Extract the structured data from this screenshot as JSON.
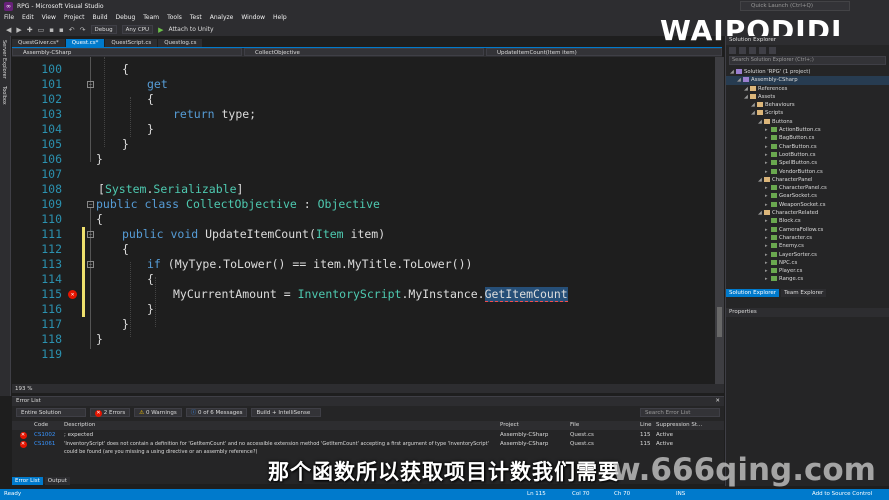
{
  "window": {
    "title": "RPG - Microsoft Visual Studio",
    "quick_launch": "Quick Launch (Ctrl+Q)",
    "user": "Kasper Frandsen",
    "avatar": "KA"
  },
  "menu": [
    "File",
    "Edit",
    "View",
    "Project",
    "Build",
    "Debug",
    "Team",
    "Tools",
    "Test",
    "Analyze",
    "Window",
    "Help"
  ],
  "toolbar": {
    "config": "Debug",
    "platform": "Any CPU",
    "attach": "Attach to Unity"
  },
  "watermark": "WAIPODIDI",
  "left_strip": [
    "Server Explorer",
    "Toolbox"
  ],
  "doc_tabs": [
    {
      "label": "QuestGiver.cs*",
      "active": false
    },
    {
      "label": "Quest.cs*",
      "active": true
    },
    {
      "label": "QuestScript.cs",
      "active": false
    },
    {
      "label": "Questlog.cs",
      "active": false
    }
  ],
  "nav": {
    "project": "Assembly-CSharp",
    "class": "CollectObjective",
    "member": "UpdateItemCount(Item item)"
  },
  "code_lines": [
    {
      "n": "100",
      "text": "{"
    },
    {
      "n": "101",
      "text": "get"
    },
    {
      "n": "102",
      "text": "{"
    },
    {
      "n": "103",
      "text": "return type;"
    },
    {
      "n": "104",
      "text": "}"
    },
    {
      "n": "105",
      "text": "}"
    },
    {
      "n": "106",
      "text": "}"
    },
    {
      "n": "107",
      "text": ""
    },
    {
      "n": "108",
      "text": "[System.Serializable]"
    },
    {
      "n": "109",
      "text": "public class CollectObjective : Objective"
    },
    {
      "n": "110",
      "text": "{"
    },
    {
      "n": "111",
      "text": "public void UpdateItemCount(Item item)"
    },
    {
      "n": "112",
      "text": "{"
    },
    {
      "n": "113",
      "text": "if (MyType.ToLower() == item.MyTitle.ToLower())"
    },
    {
      "n": "114",
      "text": "{"
    },
    {
      "n": "115",
      "text": "MyCurrentAmount = InventoryScript.MyInstance.GetItemCount"
    },
    {
      "n": "116",
      "text": "}"
    },
    {
      "n": "117",
      "text": "}"
    },
    {
      "n": "118",
      "text": "}"
    },
    {
      "n": "119",
      "text": ""
    }
  ],
  "zoom": "193 %",
  "error_list": {
    "title": "Error List",
    "scope": "Entire Solution",
    "errors_btn": "2 Errors",
    "warnings_btn": "0 Warnings",
    "messages_btn": "0 of 6 Messages",
    "build_filter": "Build + IntelliSense",
    "search": "Search Error List",
    "headers": [
      "",
      "Code",
      "Description",
      "Project",
      "File",
      "Line",
      "Suppression St..."
    ],
    "rows": [
      {
        "code": "CS1002",
        "desc": "; expected",
        "project": "Assembly-CSharp",
        "file": "Quest.cs",
        "line": "115",
        "state": "Active"
      },
      {
        "code": "CS1061",
        "desc": "'InventoryScript' does not contain a definition for 'GetItemCount' and no accessible extension method 'GetItemCount' accepting a first argument of type 'InventoryScript' could be found (are you missing a using directive or an assembly reference?)",
        "project": "Assembly-CSharp",
        "file": "Quest.cs",
        "line": "115",
        "state": "Active"
      }
    ],
    "bottom_tabs": [
      "Error List",
      "Output"
    ]
  },
  "solution_explorer": {
    "title": "Solution Explorer",
    "search": "Search Solution Explorer (Ctrl+;)",
    "items": [
      {
        "label": "Solution 'RPG' (1 project)",
        "lvl": 0
      },
      {
        "label": "Assembly-CSharp",
        "lvl": 1
      },
      {
        "label": "References",
        "lvl": 2
      },
      {
        "label": "Assets",
        "lvl": 2
      },
      {
        "label": "Behaviours",
        "lvl": 3
      },
      {
        "label": "Scripts",
        "lvl": 3
      },
      {
        "label": "Buttons",
        "lvl": 4
      },
      {
        "label": "ActionButton.cs",
        "lvl": 5
      },
      {
        "label": "BagButton.cs",
        "lvl": 5
      },
      {
        "label": "CharButton.cs",
        "lvl": 5
      },
      {
        "label": "LootButton.cs",
        "lvl": 5
      },
      {
        "label": "SpellButton.cs",
        "lvl": 5
      },
      {
        "label": "VendorButton.cs",
        "lvl": 5
      },
      {
        "label": "CharacterPanel",
        "lvl": 4
      },
      {
        "label": "CharacterPanel.cs",
        "lvl": 5
      },
      {
        "label": "GearSocket.cs",
        "lvl": 5
      },
      {
        "label": "WeaponSocket.cs",
        "lvl": 5
      },
      {
        "label": "CharacterRelated",
        "lvl": 4
      },
      {
        "label": "Block.cs",
        "lvl": 5
      },
      {
        "label": "CameraFollow.cs",
        "lvl": 5
      },
      {
        "label": "Character.cs",
        "lvl": 5
      },
      {
        "label": "Enemy.cs",
        "lvl": 5
      },
      {
        "label": "LayerSorter.cs",
        "lvl": 5
      },
      {
        "label": "NPC.cs",
        "lvl": 5
      },
      {
        "label": "Player.cs",
        "lvl": 5
      },
      {
        "label": "Range.cs",
        "lvl": 5
      }
    ],
    "tabs": [
      "Solution Explorer",
      "Team Explorer"
    ],
    "properties": "Properties"
  },
  "status": {
    "ready": "Ready",
    "ln": "Ln 115",
    "col": "Col 70",
    "ch": "Ch 70",
    "ins": "INS",
    "source_control": "Add to Source Control"
  },
  "subtitle": "那个函数所以获取项目计数我们需要",
  "site_watermark": "w.666qing.com"
}
